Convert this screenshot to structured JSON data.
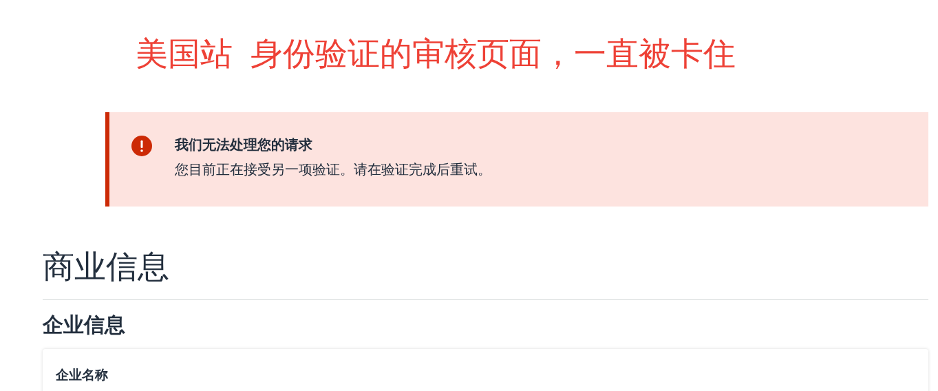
{
  "annotation": "美国站  身份验证的审核页面，一直被卡住",
  "alert": {
    "kind": "error",
    "title": "我们无法处理您的请求",
    "message": "您目前正在接受另一项验证。请在验证完成后重试。"
  },
  "page_title": "商业信息",
  "section": {
    "title": "企业信息",
    "card": {
      "label": "企业名称"
    }
  }
}
